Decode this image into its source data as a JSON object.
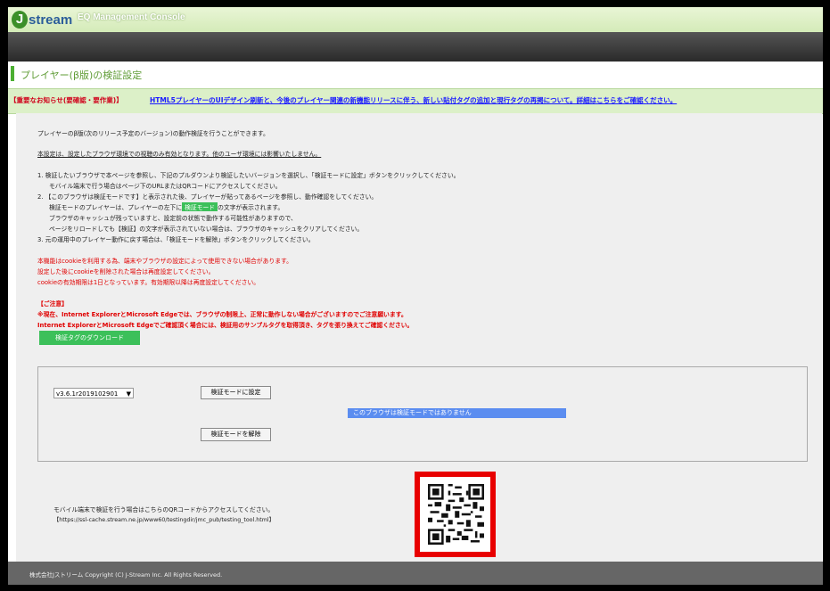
{
  "header": {
    "logo_letter": "J",
    "logo_text": "stream",
    "app_title": "EQ Management Console"
  },
  "page_title": "プレイヤー(β版)の検証設定",
  "notice": {
    "label": "【重要なお知らせ(要確認・要作業)】",
    "link": "HTML5プレイヤーのUIデザイン刷新と、今後のプレイヤー関連の新機能リリースに伴う、新しい貼付タグの追加と現行タグの再掲について。詳細はこちらをご確認ください。"
  },
  "intro": {
    "line1": "プレイヤーのβ版(次のリリース予定のバージョン)の動作検証を行うことができます。",
    "line2": "本設定は、設定したブラウザ環境での視聴のみ有効となります。他のユーザ環境には影響いたしません。"
  },
  "steps": {
    "s1a": "1. 検証したいブラウザで本ページを参照し、下記のプルダウンより検証したいバージョンを選択し、「検証モードに設定」ボタンをクリックしてください。",
    "s1b": "モバイル端末で行う場合はページ下のURLまたはQRコードにアクセスしてください。",
    "s2a": "2. 【このブラウザは検証モードです】と表示された後、プレイヤーが貼ってあるページを参照し、動作確認をしてください。",
    "s2b_pre": "検証モードのプレイヤーは、プレイヤーの左下に",
    "s2b_badge": "検証モード",
    "s2b_post": "の文字が表示されます。",
    "s2c": "ブラウザのキャッシュが残っていますと、設定前の状態で動作する可能性がありますので、",
    "s2d": "ページをリロードしても【検証】の文字が表示されていない場合は、ブラウザのキャッシュをクリアしてください。",
    "s3": "3. 元の運用中のプレイヤー動作に戻す場合は、「検証モードを解除」ボタンをクリックしてください。"
  },
  "cookie_notes": [
    "本機能はcookieを利用する為、端末やブラウザの設定によって使用できない場合があります。",
    "設定した後にcookieを削除された場合は再度設定してください。",
    "cookieの有効期限は1日となっています。有効期限以降は再度設定してください。"
  ],
  "caution": {
    "heading": "【ご注意】",
    "line1": "※現在、Internet ExplorerとMicrosoft Edgeでは、ブラウザの制限上、正常に動作しない場合がございますのでご注意願います。",
    "line2": "Internet ExplorerとMicrosoft Edgeでご確認頂く場合には、検証用のサンプルタグを取得頂き、タグを張り換えてご確認ください。"
  },
  "download_button": "検証タグのダウンロード",
  "panel": {
    "version_selected": "v3.6.1r2019102901",
    "set_button": "検証モードに設定",
    "status": "このブラウザは検証モードではありません",
    "unset_button": "検証モードを解除"
  },
  "mobile": {
    "text": "モバイル端末で検証を行う場合はこちらのQRコードからアクセスしてください。",
    "url": "【https://ssl-cache.stream.ne.jp/www60/testingdir/jmc_pub/testing_tool.html】"
  },
  "footer": "株式会社Jストリーム  Copyright (C) J-Stream Inc. All Rights Reserved.",
  "colors": {
    "accent_green": "#3cc05a",
    "notice_red": "#e00000",
    "status_blue": "#5b8df0",
    "qr_frame_red": "#e80000"
  }
}
